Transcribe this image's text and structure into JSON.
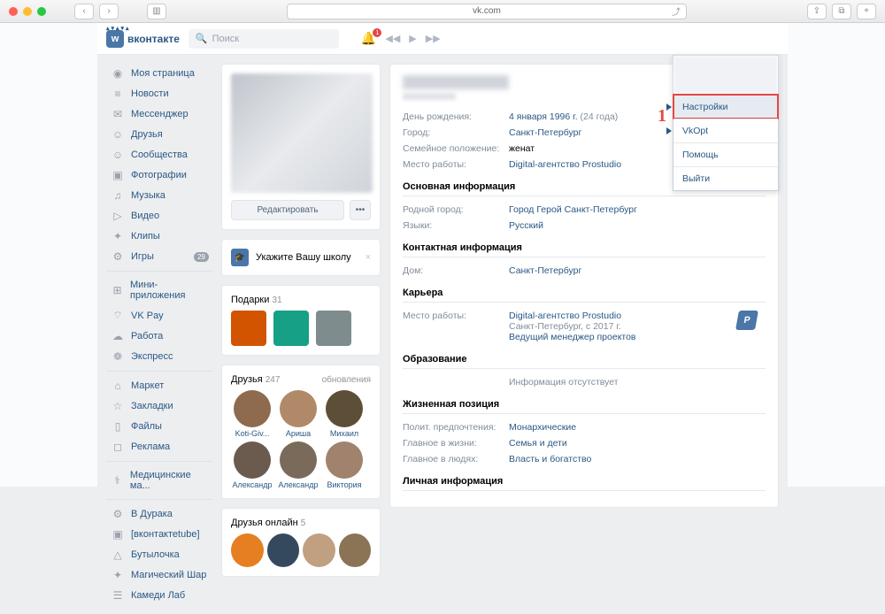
{
  "browser": {
    "url": "vk.com"
  },
  "logo": "вконтакте",
  "search": {
    "placeholder": "Поиск"
  },
  "bell_count": "1",
  "sidebar": {
    "items": [
      {
        "icon": "◉",
        "label": "Моя страница"
      },
      {
        "icon": "≡",
        "label": "Новости"
      },
      {
        "icon": "✉",
        "label": "Мессенджер"
      },
      {
        "icon": "☺",
        "label": "Друзья"
      },
      {
        "icon": "☺",
        "label": "Сообщества"
      },
      {
        "icon": "▣",
        "label": "Фотографии"
      },
      {
        "icon": "♫",
        "label": "Музыка"
      },
      {
        "icon": "▷",
        "label": "Видео"
      },
      {
        "icon": "✦",
        "label": "Клипы"
      },
      {
        "icon": "⚙",
        "label": "Игры",
        "badge": "29"
      }
    ],
    "items2": [
      {
        "icon": "⊞",
        "label": "Мини-приложения"
      },
      {
        "icon": "⌔",
        "label": "VK Pay"
      },
      {
        "icon": "☁",
        "label": "Работа"
      },
      {
        "icon": "❁",
        "label": "Экспресс"
      }
    ],
    "items3": [
      {
        "icon": "⌂",
        "label": "Маркет"
      },
      {
        "icon": "☆",
        "label": "Закладки"
      },
      {
        "icon": "▯",
        "label": "Файлы"
      },
      {
        "icon": "◻",
        "label": "Реклама"
      }
    ],
    "items4": [
      {
        "icon": "⚕",
        "label": "Медицинские ма..."
      }
    ],
    "items5": [
      {
        "icon": "⚙",
        "label": "В Дурака"
      },
      {
        "icon": "▣",
        "label": "[вконтактеtube]"
      },
      {
        "icon": "△",
        "label": "Бутылочка"
      },
      {
        "icon": "✦",
        "label": "Магический Шар"
      },
      {
        "icon": "☰",
        "label": "Камеди Лаб"
      }
    ]
  },
  "profile": {
    "edit_btn": "Редактировать",
    "dots": "•••"
  },
  "school": {
    "title": "Укажите Вашу школу"
  },
  "gifts": {
    "title": "Подарки",
    "count": "31"
  },
  "gift_colors": [
    "#d35400",
    "#16a085",
    "#7f8c8d"
  ],
  "friends": {
    "title": "Друзья",
    "count": "247",
    "upd": "обновления",
    "list": [
      {
        "name": "Koti-Giv...",
        "color": "#8e6b4e"
      },
      {
        "name": "Ариша",
        "color": "#b08968"
      },
      {
        "name": "Михаил",
        "color": "#5d4e37"
      },
      {
        "name": "Александр",
        "color": "#6b5b4f"
      },
      {
        "name": "Александр",
        "color": "#7a6a5a"
      },
      {
        "name": "Виктория",
        "color": "#a0826d"
      }
    ]
  },
  "online": {
    "title": "Друзья онлайн",
    "count": "5",
    "colors": [
      "#e67e22",
      "#34495e",
      "#c0a080",
      "#8b7355"
    ]
  },
  "info": {
    "birth_label": "День рождения:",
    "birth_val": "4 января 1996 г.",
    "birth_age": "(24 года)",
    "city_label": "Город:",
    "city_val": "Санкт-Петербург",
    "family_label": "Семейное положение:",
    "family_val": "женат",
    "work_label": "Место работы:",
    "work_val": "Digital-агентство Prostudio"
  },
  "sections": {
    "main": {
      "title": "Основная информация",
      "rows": [
        {
          "label": "Родной город:",
          "val": "Город Герой Санкт-Петербург"
        },
        {
          "label": "Языки:",
          "val": "Русский"
        }
      ]
    },
    "contact": {
      "title": "Контактная информация",
      "rows": [
        {
          "label": "Дом:",
          "val": "Санкт-Петербург"
        }
      ]
    },
    "career": {
      "title": "Карьера",
      "work_label": "Место работы:",
      "company": "Digital-агентство Prostudio",
      "location": "Санкт-Петербург, с 2017 г.",
      "position": "Ведущий менеджер проектов"
    },
    "edu": {
      "title": "Образование",
      "empty": "Информация отсутствует"
    },
    "life": {
      "title": "Жизненная позиция",
      "rows": [
        {
          "label": "Полит. предпочтения:",
          "val": "Монархические"
        },
        {
          "label": "Главное в жизни:",
          "val": "Семья и дети"
        },
        {
          "label": "Главное в людях:",
          "val": "Власть и богатство"
        }
      ]
    },
    "personal": {
      "title": "Личная информация"
    }
  },
  "dropdown": {
    "items": [
      "Настройки",
      "VkOpt",
      "Помощь",
      "Выйти"
    ],
    "active": 0
  },
  "annotation": "1"
}
